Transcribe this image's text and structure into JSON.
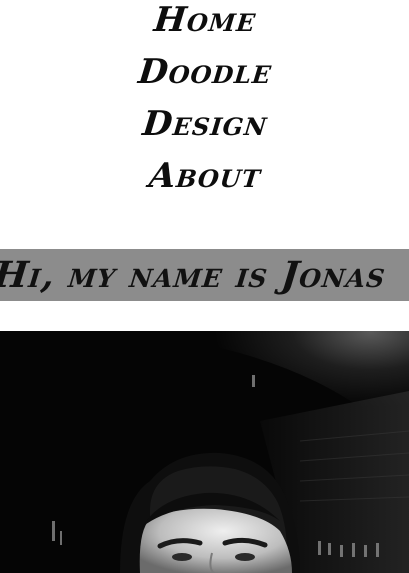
{
  "nav": {
    "items": [
      {
        "label": "Home"
      },
      {
        "label": "Doodle"
      },
      {
        "label": "Design"
      },
      {
        "label": "About"
      }
    ]
  },
  "hero": {
    "title": "Hi, my name is Jonas"
  },
  "colors": {
    "text": "#0d0d0d",
    "hero_band": "#8c8c8c",
    "background": "#ffffff"
  }
}
